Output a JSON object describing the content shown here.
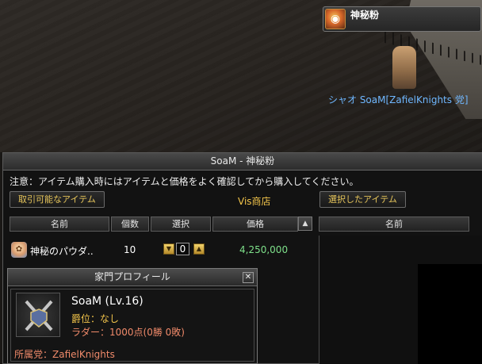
{
  "buff": {
    "label": "神秘粉",
    "icon": "mystery-powder-icon"
  },
  "player": {
    "name": "シャオ SoaM[ZafielKnights 党]"
  },
  "shop": {
    "title": "SoaM - 神秘粉",
    "notice": "注意：アイテム購入時にはアイテムと価格をよく確認してから購入してください。",
    "available_tab": "取引可能なアイテム",
    "shop_name": "Vis商店",
    "selected_tab": "選択したアイテム",
    "columns": [
      "名前",
      "個数",
      "選択",
      "価格"
    ],
    "right_column": "名前",
    "items": [
      {
        "name": "神秘のパウダ..",
        "qty": "10",
        "select": "0",
        "price": "4,250,000",
        "icon": "powder-icon"
      }
    ]
  },
  "profile": {
    "title": "家門プロフィール",
    "name": "SoaM (Lv.16)",
    "rank": "爵位：なし",
    "ladder": "ラダー：1000点(0勝 0敗)",
    "party": "所属党：ZafielKnights"
  },
  "colors": {
    "gold": "#f2c44a",
    "price": "#7ee08a",
    "name_blue": "#6fb7ff",
    "salmon": "#f08a6a"
  }
}
